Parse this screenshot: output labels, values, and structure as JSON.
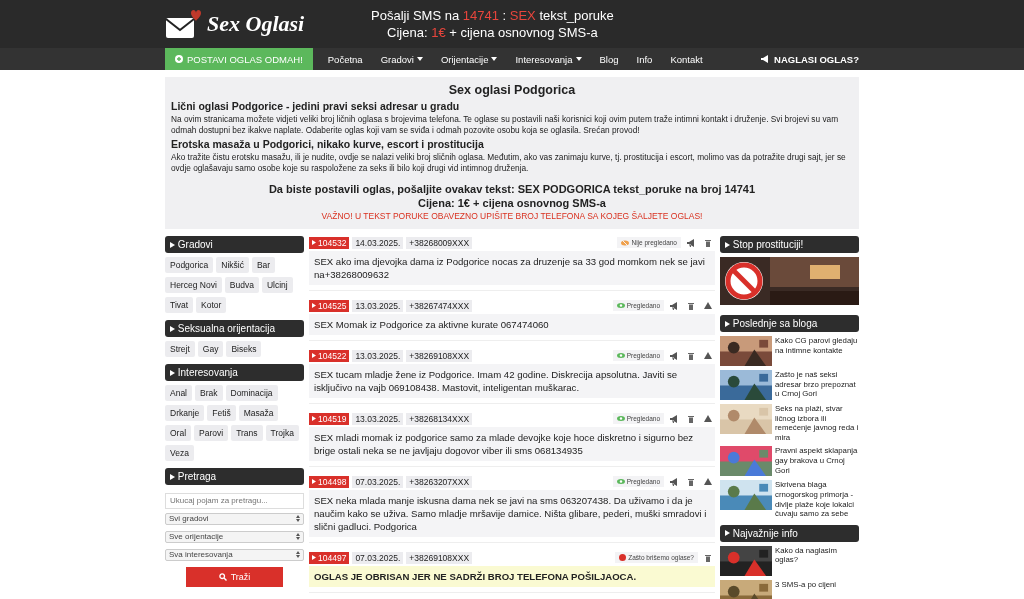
{
  "header": {
    "logo": "Sex Oglasi",
    "sms_line": [
      {
        "text": "Pošalji SMS na ",
        "accent": false
      },
      {
        "text": "14741",
        "accent": true
      },
      {
        "text": " : ",
        "accent": false
      },
      {
        "text": "SEX",
        "accent": true
      },
      {
        "text": " tekst_poruke",
        "accent": false
      }
    ],
    "price_line": [
      {
        "text": "Cijena: ",
        "accent": false
      },
      {
        "text": "1€",
        "accent": true
      },
      {
        "text": " + cijena osnovnog SMS-a",
        "accent": false
      }
    ]
  },
  "nav": {
    "cta": "POSTAVI OGLAS ODMAH!",
    "items": [
      {
        "label": "Početna",
        "dropdown": false
      },
      {
        "label": "Gradovi",
        "dropdown": true
      },
      {
        "label": "Orijentacije",
        "dropdown": true
      },
      {
        "label": "Interesovanja",
        "dropdown": true
      },
      {
        "label": "Blog",
        "dropdown": false
      },
      {
        "label": "Info",
        "dropdown": false
      },
      {
        "label": "Kontakt",
        "dropdown": false
      }
    ],
    "promote": "NAGLASI OGLAS?"
  },
  "intro": {
    "title": "Sex oglasi Podgorica",
    "sections": [
      {
        "heading": "Lični oglasi Podgorice - jedini pravi seksi adresar u gradu",
        "text": "Na ovim stranicama možete vidjeti veliki broj ličnih oglasa s brojevima telefona. Te oglase su postavili naši korisnici koji ovim putem traže intimni kontakt i druženje. Svi brojevi su vam odmah dostupni bez ikakve naplate. Odaberite oglas koji vam se sviđa i odmah pozovite osobu koja se oglasila. Srećan provod!"
      },
      {
        "heading": "Erotska masaža u Podgorici, nikako kurve, escort i prostitucija",
        "text": "Ako tražite čistu erotsku masažu, ili je nudite, ovdje se nalazi veliki broj sličnih oglasa. Međutim, ako vas zanimaju kurve, tj. prostitucija i escort, molimo vas da potražite drugi sajt, jer se ovdje oglašavaju samo osobe koje su raspoložene za seks ili bilo koji drugi vid intimnog druženja."
      }
    ],
    "instruction": "Da biste postavili oglas, pošaljite ovakav tekst: SEX PODGORICA tekst_poruke na broj 14741",
    "price": "Cijena: 1€ + cijena osnovnog SMS-a",
    "warning": "VAŽNO! U TEKST PORUKE OBAVEZNO UPIŠITE BROJ TELEFONA SA KOJEG ŠALJETE OGLAS!"
  },
  "sidebar": {
    "groups": [
      {
        "title": "Gradovi",
        "tags": [
          "Podgorica",
          "Nikšić",
          "Bar",
          "Herceg Novi",
          "Budva",
          "Ulcinj",
          "Tivat",
          "Kotor"
        ]
      },
      {
        "title": "Seksualna orijentacija",
        "tags": [
          "Strejt",
          "Gay",
          "Biseks"
        ]
      },
      {
        "title": "Interesovanja",
        "tags": [
          "Anal",
          "Brak",
          "Dominacija",
          "Drkanje",
          "Fetiš",
          "Masaža",
          "Oral",
          "Parovi",
          "Trans",
          "Trojka",
          "Veza"
        ]
      }
    ],
    "search": {
      "title": "Pretraga",
      "placeholder": "Ukucaj pojam za pretragu...",
      "selects": [
        "Svi gradovi",
        "Sve orijentacije",
        "Sva interesovanja"
      ],
      "button": "Traži"
    }
  },
  "ads": [
    {
      "id": "104532",
      "date": "14.03.2025.",
      "phone": "+38268009XXX",
      "status": "Nije pregledano",
      "kind": "unviewed",
      "reportable": false,
      "text": "SEX ako ima djevojka dama iz Podgorice nocas za druzenje sa 33 god momkom nek se javi na+38268009632"
    },
    {
      "id": "104525",
      "date": "13.03.2025.",
      "phone": "+38267474XXX",
      "status": "Pregledano",
      "kind": "viewed",
      "reportable": true,
      "text": "SEX Momak iz Podgorice za aktivne kurate 067474060"
    },
    {
      "id": "104522",
      "date": "13.03.2025.",
      "phone": "+38269108XXX",
      "status": "Pregledano",
      "kind": "viewed",
      "reportable": true,
      "text": "SEX tucam mladje žene iz Podgorice. Imam 42 godine. Diskrecija apsolutna. Javiti se isključivo na vajb 069108438. Mastovit, inteligentan muškarac."
    },
    {
      "id": "104519",
      "date": "13.03.2025.",
      "phone": "+38268134XXX",
      "status": "Pregledano",
      "kind": "viewed",
      "reportable": true,
      "text": "SEX mladi momak iz podgorice samo za mlade devojke koje hoce diskretno i sigurno bez brige ostali neka se ne javljaju dogovor viber ili sms 068134935"
    },
    {
      "id": "104498",
      "date": "07.03.2025.",
      "phone": "+38263207XXX",
      "status": "Pregledano",
      "kind": "viewed",
      "reportable": true,
      "text": "SEX neka mlada manje iskusna dama nek se javi na sms 063207438. Da uživamo i da je naučim kako se uživa. Samo mladje mršavije damice. Ništa glibare, pederi, muški smradovi i slični gadluci. Podgorica"
    },
    {
      "id": "104497",
      "date": "07.03.2025.",
      "phone": "+38269108XXX",
      "status": "Zašto brišemo oglase?",
      "kind": "deleted",
      "reportable": false,
      "text": "OGLAS JE OBRISAN JER NE SADRŽI BROJ TELEFONA POŠILJAOCA."
    }
  ],
  "right": {
    "stop": {
      "title": "Stop prostituciji!"
    },
    "blog": {
      "title": "Poslednje sa bloga",
      "posts": [
        {
          "title": "Kako CG parovi gledaju na intimne kontakte"
        },
        {
          "title": "Zašto je naš seksi adresar brzo prepoznat u Crnoj Gori"
        },
        {
          "title": "Seks na plaži, stvar ličnog izbora ili remećenje javnog reda i mira"
        },
        {
          "title": "Pravni aspekt sklapanja gay brakova u Crnoj Gori"
        },
        {
          "title": "Skrivena blaga crnogorskog primorja - divlje plaže koje lokalci čuvaju samo za sebe"
        }
      ]
    },
    "info": {
      "title": "Najvažnije info",
      "posts": [
        {
          "title": "Kako da naglasim oglas?"
        },
        {
          "title": "3 SMS-a po cijeni"
        }
      ]
    }
  }
}
